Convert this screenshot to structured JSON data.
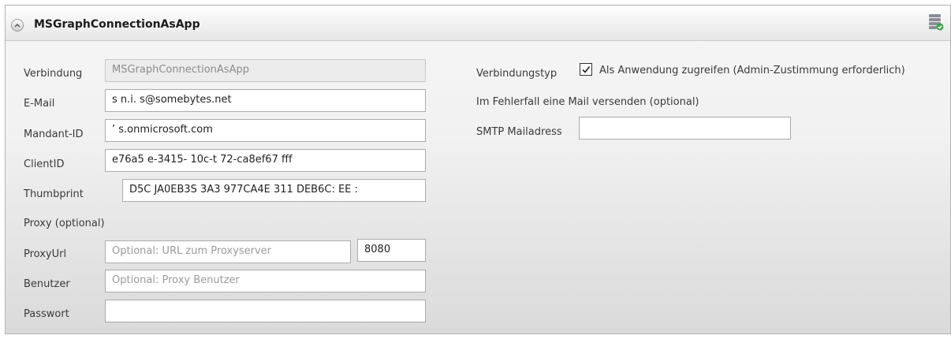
{
  "panel": {
    "title": "MSGraphConnectionAsApp",
    "collapse_icon": "chevron-up-icon",
    "status_icon": "server-check-icon"
  },
  "left": {
    "verbindung": {
      "label": "Verbindung",
      "value": "MSGraphConnectionAsApp"
    },
    "email": {
      "label": "E-Mail",
      "value": "s   n.i.  s@somebytes.net"
    },
    "mandant": {
      "label": "Mandant-ID",
      "value": "      ’           s.onmicrosoft.com"
    },
    "clientid": {
      "label": "ClientID",
      "value": "e76a5   e-3415-  10c-t  72-ca8ef67    fff"
    },
    "thumbprint": {
      "label": "Thumbprint",
      "value": "D5C  JA0EB3S   3A3   977CA4E  311   DEB6C:  EE   :"
    },
    "proxy_header": "Proxy (optional)",
    "proxyurl": {
      "label": "ProxyUrl",
      "placeholder": "Optional: URL zum Proxyserver",
      "port": "8080"
    },
    "benutzer": {
      "label": "Benutzer",
      "placeholder": "Optional: Proxy Benutzer"
    },
    "passwort": {
      "label": "Passwort",
      "value": ""
    }
  },
  "right": {
    "verbindungstyp": {
      "label": "Verbindungstyp",
      "checkbox_label": "Als Anwendung zugreifen (Admin-Zustimmung erforderlich)",
      "checked": true
    },
    "error_mail_header": "Im Fehlerfall eine Mail versenden (optional)",
    "smtp": {
      "label": "SMTP Mailadress",
      "value": ""
    }
  },
  "colors": {
    "panel_border": "#b4b4b4",
    "field_border": "#ababab",
    "disabled_bg": "#ececec",
    "status_green": "#3aa545"
  }
}
